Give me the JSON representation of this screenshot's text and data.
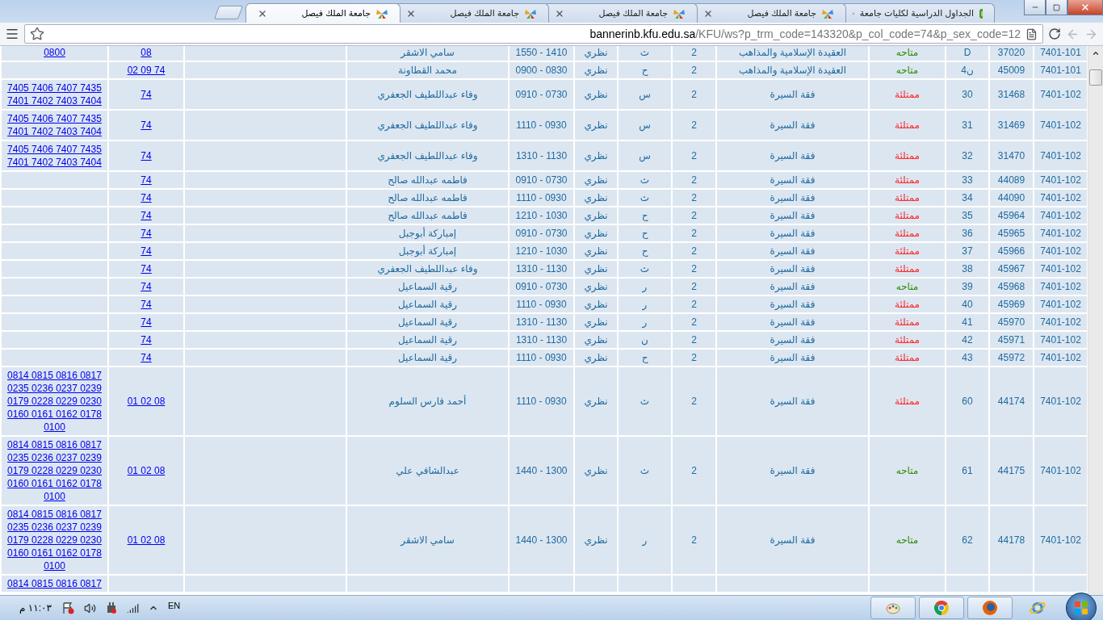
{
  "browser": {
    "tabs": [
      {
        "title": "الجداول الدراسية لكليات جامعة",
        "selected": false,
        "kind": "kfu"
      },
      {
        "title": "جامعة الملك فيصل",
        "selected": false,
        "kind": "site"
      },
      {
        "title": "جامعة الملك فيصل",
        "selected": false,
        "kind": "site"
      },
      {
        "title": "جامعة الملك فيصل",
        "selected": false,
        "kind": "site"
      },
      {
        "title": "جامعة الملك فيصل",
        "selected": true,
        "kind": "site"
      }
    ],
    "address": {
      "host": "bannerinb.kfu.edu.sa",
      "path": "/KFU/ws?p_trm_code=143320&p_col_code=74&p_sex_code=12"
    },
    "back": {
      "disabled": true
    },
    "forward": {
      "disabled": true
    }
  },
  "table": {
    "rows": [
      {
        "column_1": "7401-101",
        "column_2": "37020",
        "column_3": "D",
        "column_4": {
          "text": "متاحه",
          "color": "#2e8b00"
        },
        "column_5": "العقيدة الإسلامية والمذاهب",
        "column_6": "2",
        "column_7": "ث",
        "column_8": "نظري",
        "column_9": "1550 - 1410",
        "column_10": "سامي الاشقر",
        "column_12": "08",
        "column_13": "0800"
      },
      {
        "column_1": "7401-101",
        "column_2": "45009",
        "column_3": "ن4",
        "column_4": {
          "text": "متاحه",
          "color": "#2e8b00"
        },
        "column_5": "العقيدة الإسلامية والمذاهب",
        "column_6": "2",
        "column_7": "ح",
        "column_8": "نظري",
        "column_9": "0900 - 0830",
        "column_10": "محمد القطاونة",
        "column_12": "02 09 74"
      },
      {
        "column_1": "7401-102",
        "column_2": "31468",
        "column_3": "30",
        "column_4": {
          "text": "ممتلئة",
          "color": "#ff1f1f"
        },
        "column_5": "فقة السيرة",
        "column_6": "2",
        "column_7": "س",
        "column_8": "نظري",
        "column_9": "0910 - 0730",
        "column_10": "وفاء عبداللطيف الجعفري",
        "column_12": "74",
        "column_13": "7405 7406 7407 7435 7401 7402 7403 7404"
      },
      {
        "column_1": "7401-102",
        "column_2": "31469",
        "column_3": "31",
        "column_4": {
          "text": "ممتلئة",
          "color": "#ff1f1f"
        },
        "column_5": "فقة السيرة",
        "column_6": "2",
        "column_7": "س",
        "column_8": "نظري",
        "column_9": "1110 - 0930",
        "column_10": "وفاء عبداللطيف الجعفري",
        "column_12": "74",
        "column_13": "7405 7406 7407 7435 7401 7402 7403 7404"
      },
      {
        "column_1": "7401-102",
        "column_2": "31470",
        "column_3": "32",
        "column_4": {
          "text": "ممتلئة",
          "color": "#ff1f1f"
        },
        "column_5": "فقة السيرة",
        "column_6": "2",
        "column_7": "س",
        "column_8": "نظري",
        "column_9": "1310 - 1130",
        "column_10": "وفاء عبداللطيف الجعفري",
        "column_12": "74",
        "column_13": "7405 7406 7407 7435 7401 7402 7403 7404"
      },
      {
        "column_1": "7401-102",
        "column_2": "44089",
        "column_3": "33",
        "column_4": {
          "text": "ممتلئة",
          "color": "#ff1f1f"
        },
        "column_5": "فقة السيرة",
        "column_6": "2",
        "column_7": "ث",
        "column_8": "نظري",
        "column_9": "0910 - 0730",
        "column_10": "فاطمه عبدالله صالح",
        "column_12": "74"
      },
      {
        "column_1": "7401-102",
        "column_2": "44090",
        "column_3": "34",
        "column_4": {
          "text": "ممتلئة",
          "color": "#ff1f1f"
        },
        "column_5": "فقة السيرة",
        "column_6": "2",
        "column_7": "ث",
        "column_8": "نظري",
        "column_9": "1110 - 0930",
        "column_10": "فاطمه عبدالله صالح",
        "column_12": "74"
      },
      {
        "column_1": "7401-102",
        "column_2": "45964",
        "column_3": "35",
        "column_4": {
          "text": "ممتلئة",
          "color": "#ff1f1f"
        },
        "column_5": "فقة السيرة",
        "column_6": "2",
        "column_7": "ح",
        "column_8": "نظري",
        "column_9": "1210 - 1030",
        "column_10": "فاطمه عبدالله صالح",
        "column_12": "74"
      },
      {
        "column_1": "7401-102",
        "column_2": "45965",
        "column_3": "36",
        "column_4": {
          "text": "ممتلئة",
          "color": "#ff1f1f"
        },
        "column_5": "فقة السيرة",
        "column_6": "2",
        "column_7": "ح",
        "column_8": "نظري",
        "column_9": "0910 - 0730",
        "column_10": "إمباركة أبوجبل",
        "column_12": "74"
      },
      {
        "column_1": "7401-102",
        "column_2": "45966",
        "column_3": "37",
        "column_4": {
          "text": "ممتلئة",
          "color": "#ff1f1f"
        },
        "column_5": "فقة السيرة",
        "column_6": "2",
        "column_7": "ح",
        "column_8": "نظري",
        "column_9": "1210 - 1030",
        "column_10": "إمباركة أبوجبل",
        "column_12": "74"
      },
      {
        "column_1": "7401-102",
        "column_2": "45967",
        "column_3": "38",
        "column_4": {
          "text": "ممتلئة",
          "color": "#ff1f1f"
        },
        "column_5": "فقة السيرة",
        "column_6": "2",
        "column_7": "ث",
        "column_8": "نظري",
        "column_9": "1310 - 1130",
        "column_10": "وفاء عبداللطيف الجعفري",
        "column_12": "74"
      },
      {
        "column_1": "7401-102",
        "column_2": "45968",
        "column_3": "39",
        "column_4": {
          "text": "متاحه",
          "color": "#2e8b00"
        },
        "column_5": "فقة السيرة",
        "column_6": "2",
        "column_7": "ر",
        "column_8": "نظري",
        "column_9": "0910 - 0730",
        "column_10": "رقية السماعيل",
        "column_12": "74"
      },
      {
        "column_1": "7401-102",
        "column_2": "45969",
        "column_3": "40",
        "column_4": {
          "text": "ممتلئة",
          "color": "#ff1f1f"
        },
        "column_5": "فقة السيرة",
        "column_6": "2",
        "column_7": "ر",
        "column_8": "نظري",
        "column_9": "1110 - 0930",
        "column_10": "رقية السماعيل",
        "column_12": "74"
      },
      {
        "column_1": "7401-102",
        "column_2": "45970",
        "column_3": "41",
        "column_4": {
          "text": "ممتلئة",
          "color": "#ff1f1f"
        },
        "column_5": "فقة السيرة",
        "column_6": "2",
        "column_7": "ر",
        "column_8": "نظري",
        "column_9": "1310 - 1130",
        "column_10": "رقية السماعيل",
        "column_12": "74"
      },
      {
        "column_1": "7401-102",
        "column_2": "45971",
        "column_3": "42",
        "column_4": {
          "text": "ممتلئة",
          "color": "#ff1f1f"
        },
        "column_5": "فقة السيرة",
        "column_6": "2",
        "column_7": "ن",
        "column_8": "نظري",
        "column_9": "1310 - 1130",
        "column_10": "رقية السماعيل",
        "column_12": "74"
      },
      {
        "column_1": "7401-102",
        "column_2": "45972",
        "column_3": "43",
        "column_4": {
          "text": "ممتلئة",
          "color": "#ff1f1f"
        },
        "column_5": "فقة السيرة",
        "column_6": "2",
        "column_7": "ح",
        "column_8": "نظري",
        "column_9": "1110 - 0930",
        "column_10": "رقية السماعيل",
        "column_12": "74"
      },
      {
        "column_1": "7401-102",
        "column_2": "44174",
        "column_3": "60",
        "column_4": {
          "text": "ممتلئة",
          "color": "#ff1f1f"
        },
        "column_5": "فقة السيرة",
        "column_6": "2",
        "column_7": "ث",
        "column_8": "نظري",
        "column_9": "1110 - 0930",
        "column_10": "أحمد فارس السلوم",
        "column_12": "01 02 08",
        "column_13": "0814 0815 0816 0817 0235 0236 0237 0239 0179 0228 0229 0230 0160 0161 0162 0178 0100"
      },
      {
        "column_1": "7401-102",
        "column_2": "44175",
        "column_3": "61",
        "column_4": {
          "text": "متاحه",
          "color": "#2e8b00"
        },
        "column_5": "فقة السيرة",
        "column_6": "2",
        "column_7": "ث",
        "column_8": "نظري",
        "column_9": "1440 - 1300",
        "column_10": "عبدالشافي علي",
        "column_12": "01 02 08",
        "column_13": "0814 0815 0816 0817 0235 0236 0237 0239 0179 0228 0229 0230 0160 0161 0162 0178 0100"
      },
      {
        "column_1": "7401-102",
        "column_2": "44178",
        "column_3": "62",
        "column_4": {
          "text": "متاحه",
          "color": "#2e8b00"
        },
        "column_5": "فقة السيرة",
        "column_6": "2",
        "column_7": "ر",
        "column_8": "نظري",
        "column_9": "1440 - 1300",
        "column_10": "سامي الاشقر",
        "column_12": "01 02 08",
        "column_13": "0814 0815 0816 0817 0235 0236 0237 0239 0179 0228 0229 0230 0160 0161 0162 0178 0100"
      },
      {
        "column_13": "0814 0815 0816 0817"
      }
    ]
  },
  "taskbar": {
    "clock": "١١:٠٣ م",
    "language": "EN"
  }
}
